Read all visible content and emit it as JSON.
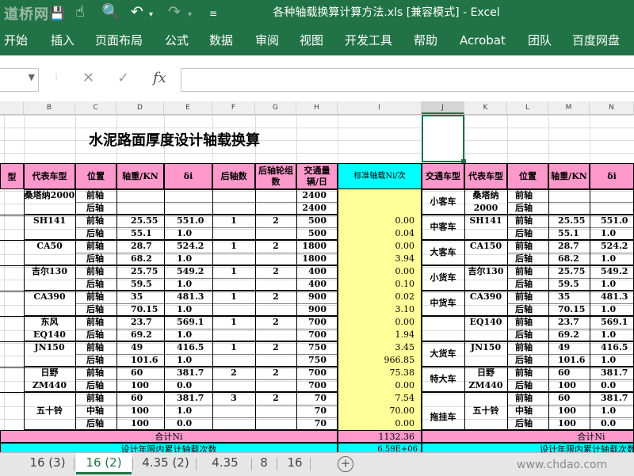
{
  "window": {
    "title": "各种轴载换算计算方法.xls  [兼容模式]  -  Excel",
    "watermark": "道桥网"
  },
  "quick_access": {
    "save_icon": "save-icon",
    "touch_icon": "touch-mode-icon",
    "preview_icon": "print-preview-icon",
    "undo_icon": "undo-icon",
    "redo_icon": "redo-icon"
  },
  "ribbon_tabs": [
    "开始",
    "插入",
    "页面布局",
    "公式",
    "数据",
    "审阅",
    "视图",
    "开发工具",
    "帮助",
    "Acrobat",
    "团队",
    "百度网盘"
  ],
  "formula_bar": {
    "name_box": "",
    "cancel": "✕",
    "enter": "✓",
    "fx": "fx",
    "formula": ""
  },
  "columns": [
    "B",
    "C",
    "D",
    "E",
    "F",
    "G",
    "H",
    "I",
    "J",
    "K",
    "L",
    "M",
    "N"
  ],
  "sheet": {
    "title": "水泥路面厚度设计轴载换算",
    "headers": [
      "代表车型",
      "位置",
      "轴重/KN",
      "δi",
      "后轴数",
      "后轴轮组数",
      "交通量辆/日",
      "标准轴载Ni/次",
      "交通车型",
      "代表车型",
      "位置",
      "轴重/KN",
      "δi"
    ],
    "left_cut_header": "型",
    "rows": [
      {
        "b": "桑塔纳2000",
        "c": "前轴",
        "d": "",
        "e": "",
        "f": "",
        "g": "",
        "h": "2400",
        "i": "",
        "j": "小客车",
        "k": "桑塔纳2000",
        "l": "前轴",
        "m": "",
        "n": ""
      },
      {
        "b": "",
        "c": "后轴",
        "d": "",
        "e": "",
        "f": "",
        "g": "",
        "h": "2400",
        "i": "",
        "j": "",
        "k": "",
        "l": "后轴",
        "m": "",
        "n": ""
      },
      {
        "b": "SH141",
        "c": "前轴",
        "d": "25.55",
        "e": "551.0",
        "f": "1",
        "g": "2",
        "h": "500",
        "i": "0.00",
        "j": "中客车",
        "k": "SH141",
        "l": "前轴",
        "m": "25.55",
        "n": "551.0"
      },
      {
        "b": "",
        "c": "后轴",
        "d": "55.1",
        "e": "1.0",
        "f": "",
        "g": "",
        "h": "500",
        "i": "0.04",
        "j": "",
        "k": "",
        "l": "后轴",
        "m": "55.1",
        "n": "1.0"
      },
      {
        "b": "CA50",
        "c": "前轴",
        "d": "28.7",
        "e": "524.2",
        "f": "1",
        "g": "2",
        "h": "1800",
        "i": "0.00",
        "j": "大客车",
        "k": "CA150",
        "l": "前轴",
        "m": "28.7",
        "n": "524.2"
      },
      {
        "b": "",
        "c": "后轴",
        "d": "68.2",
        "e": "1.0",
        "f": "",
        "g": "",
        "h": "1800",
        "i": "3.94",
        "j": "",
        "k": "",
        "l": "后轴",
        "m": "68.2",
        "n": "1.0"
      },
      {
        "b": "吉尔130",
        "c": "前轴",
        "d": "25.75",
        "e": "549.2",
        "f": "1",
        "g": "2",
        "h": "400",
        "i": "0.00",
        "j": "小货车",
        "k": "吉尔130",
        "l": "前轴",
        "m": "25.75",
        "n": "549.2"
      },
      {
        "b": "",
        "c": "后轴",
        "d": "59.5",
        "e": "1.0",
        "f": "",
        "g": "",
        "h": "400",
        "i": "0.10",
        "j": "",
        "k": "",
        "l": "后轴",
        "m": "59.5",
        "n": "1.0"
      },
      {
        "b": "CA390",
        "c": "前轴",
        "d": "35",
        "e": "481.3",
        "f": "1",
        "g": "2",
        "h": "900",
        "i": "0.02",
        "j": "中货车",
        "k": "CA390",
        "l": "前轴",
        "m": "35",
        "n": "481.3"
      },
      {
        "b": "",
        "c": "后轴",
        "d": "70.15",
        "e": "1.0",
        "f": "",
        "g": "",
        "h": "900",
        "i": "3.10",
        "j": "",
        "k": "",
        "l": "后轴",
        "m": "70.15",
        "n": "1.0"
      },
      {
        "b": "东风",
        "c": "前轴",
        "d": "23.7",
        "e": "569.1",
        "f": "1",
        "g": "2",
        "h": "700",
        "i": "0.00",
        "j": "",
        "k": "EQ140",
        "l": "前轴",
        "m": "23.7",
        "n": "569.1"
      },
      {
        "b": "EQ140",
        "c": "后轴",
        "d": "69.2",
        "e": "1.0",
        "f": "",
        "g": "",
        "h": "700",
        "i": "1.94",
        "j": "",
        "k": "",
        "l": "后轴",
        "m": "69.2",
        "n": "1.0"
      },
      {
        "b": "JN150",
        "c": "前轴",
        "d": "49",
        "e": "416.5",
        "f": "1",
        "g": "2",
        "h": "750",
        "i": "3.45",
        "j": "大货车",
        "k": "JN150",
        "l": "前轴",
        "m": "49",
        "n": "416.5"
      },
      {
        "b": "",
        "c": "后轴",
        "d": "101.6",
        "e": "1.0",
        "f": "",
        "g": "",
        "h": "750",
        "i": "966.85",
        "j": "",
        "k": "",
        "l": "后轴",
        "m": "101.6",
        "n": "1.0"
      },
      {
        "b": "日野",
        "c": "前轴",
        "d": "60",
        "e": "381.7",
        "f": "2",
        "g": "2",
        "h": "700",
        "i": "75.38",
        "j": "特大车",
        "k": "日野",
        "l": "前轴",
        "m": "60",
        "n": "381.7"
      },
      {
        "b": "ZM440",
        "c": "后轴",
        "d": "100",
        "e": "0.0",
        "f": "",
        "g": "",
        "h": "700",
        "i": "0.00",
        "j": "",
        "k": "ZM440",
        "l": "后轴",
        "m": "100",
        "n": "0.0"
      },
      {
        "b": "",
        "c": "前轴",
        "d": "60",
        "e": "381.7",
        "f": "3",
        "g": "2",
        "h": "70",
        "i": "7.54",
        "j": "",
        "k": "",
        "l": "前轴",
        "m": "60",
        "n": "381.7"
      },
      {
        "b": "五十铃",
        "c": "中轴",
        "d": "100",
        "e": "1.0",
        "f": "",
        "g": "",
        "h": "70",
        "i": "70.00",
        "j": "拖挂车",
        "k": "五十铃",
        "l": "中轴",
        "m": "100",
        "n": "1.0"
      },
      {
        "b": "",
        "c": "后轴",
        "d": "100",
        "e": "0.0",
        "f": "",
        "g": "",
        "h": "70",
        "i": "0.00",
        "j": "",
        "k": "",
        "l": "后轴",
        "m": "100",
        "n": "0.0"
      }
    ],
    "total_label": "合计Ni",
    "total_value": "1132.36",
    "cum_label": "设计年限内累计轴载次数",
    "cum_value": "6.59E+06",
    "total_label_right": "合计Ni",
    "cum_label_right": "设计年限内累计轴载次数"
  },
  "sheet_tabs": [
    "16 (3)",
    "16 (2)",
    "4.35 (2)",
    "4.35",
    "8",
    "16"
  ],
  "active_sheet": "16 (2)",
  "add_sheet": "+",
  "bottom_watermark": "www.chdao.com",
  "colors": {
    "excel_green": "#217346",
    "pink": "#ff99cc",
    "yellow": "#ffff99",
    "cyan": "#00ffff"
  }
}
